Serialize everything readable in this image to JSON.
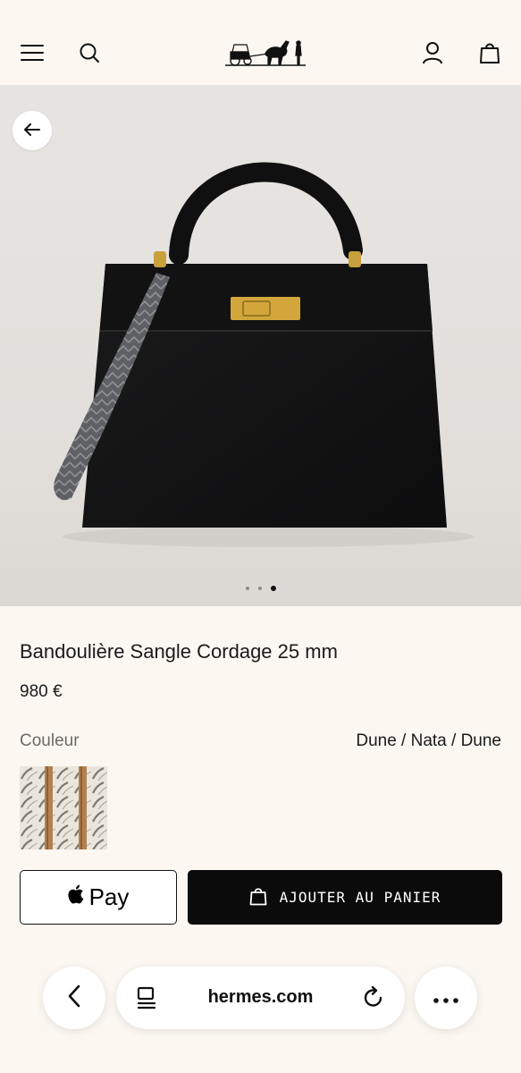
{
  "header": {
    "menu_icon": "hamburger-menu-icon",
    "search_icon": "search-icon",
    "logo": "hermes-carriage-logo",
    "account_icon": "user-icon",
    "bag_icon": "shopping-bag-icon"
  },
  "gallery": {
    "back_icon": "arrow-left-icon",
    "image_count": 3,
    "active_index": 2
  },
  "product": {
    "title": "Bandoulière Sangle Cordage 25 mm",
    "price": "980 €",
    "color_label": "Couleur",
    "color_value": "Dune / Nata / Dune"
  },
  "actions": {
    "apple_pay_label": "Pay",
    "add_to_cart_label": "AJOUTER AU PANIER"
  },
  "browser": {
    "url": "hermes.com",
    "back_icon": "chevron-left-icon",
    "tabs_icon": "reader-icon",
    "reload_icon": "reload-icon",
    "more_icon": "more-dots-icon"
  },
  "colors": {
    "background": "#fcf7f1",
    "button_dark": "#0b0b0b",
    "hero_bg": "#e4e1dd"
  }
}
